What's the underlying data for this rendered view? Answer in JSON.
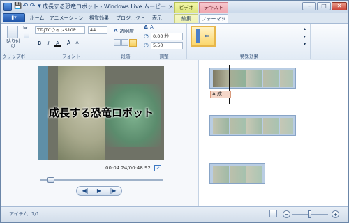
{
  "window": {
    "title": "成長する恐竜ロボット - Windows Live ムービー メー...",
    "minimize": "–",
    "maximize": "□",
    "close": "✕"
  },
  "quick_access": {
    "save": "💾",
    "undo": "↶",
    "redo": "↷",
    "dropdown": "▾"
  },
  "context_tabs": {
    "video_tools": "ビデオ ツール",
    "text_tools": "テキスト ツール"
  },
  "tabs": {
    "file_menu": "▮▾",
    "items": [
      "ホーム",
      "アニメーション",
      "視覚効果",
      "プロジェクト",
      "表示",
      "編集",
      "フォーマット"
    ],
    "selected": "フォーマット"
  },
  "ribbon": {
    "clipboard": {
      "paste_label": "貼り付け",
      "group_label": "クリップボード"
    },
    "font": {
      "font_name": "TT-JTCウインS10P",
      "font_size": "44",
      "bold": "B",
      "italic": "I",
      "color": "A",
      "grow": "A",
      "shrink": "A",
      "group_label": "フォント"
    },
    "paragraph": {
      "transparency_label": "透明度",
      "group_label": "段落"
    },
    "adjust": {
      "start_time": "0.00 秒",
      "duration": "5.50",
      "group_label": "調整"
    },
    "effects": {
      "group_label": "特殊効果"
    }
  },
  "preview": {
    "caption": "成長する恐竜ロボット",
    "time": "00:04.24/00:48.92",
    "seek_progress": 0.087,
    "prev_frame": "◀|",
    "play": "▶",
    "next_frame": "|▶"
  },
  "storyboard": {
    "text_chip": "A 成"
  },
  "status": {
    "items": "アイテム: 1/1",
    "zoom_out": "−",
    "zoom_in": "+",
    "zoom_level": 0.5
  },
  "colors": {
    "accent": "#2a62b8",
    "video_tools": "#dbe47a",
    "text_tools": "#eea3ad",
    "selection": "#f7cf5d"
  }
}
